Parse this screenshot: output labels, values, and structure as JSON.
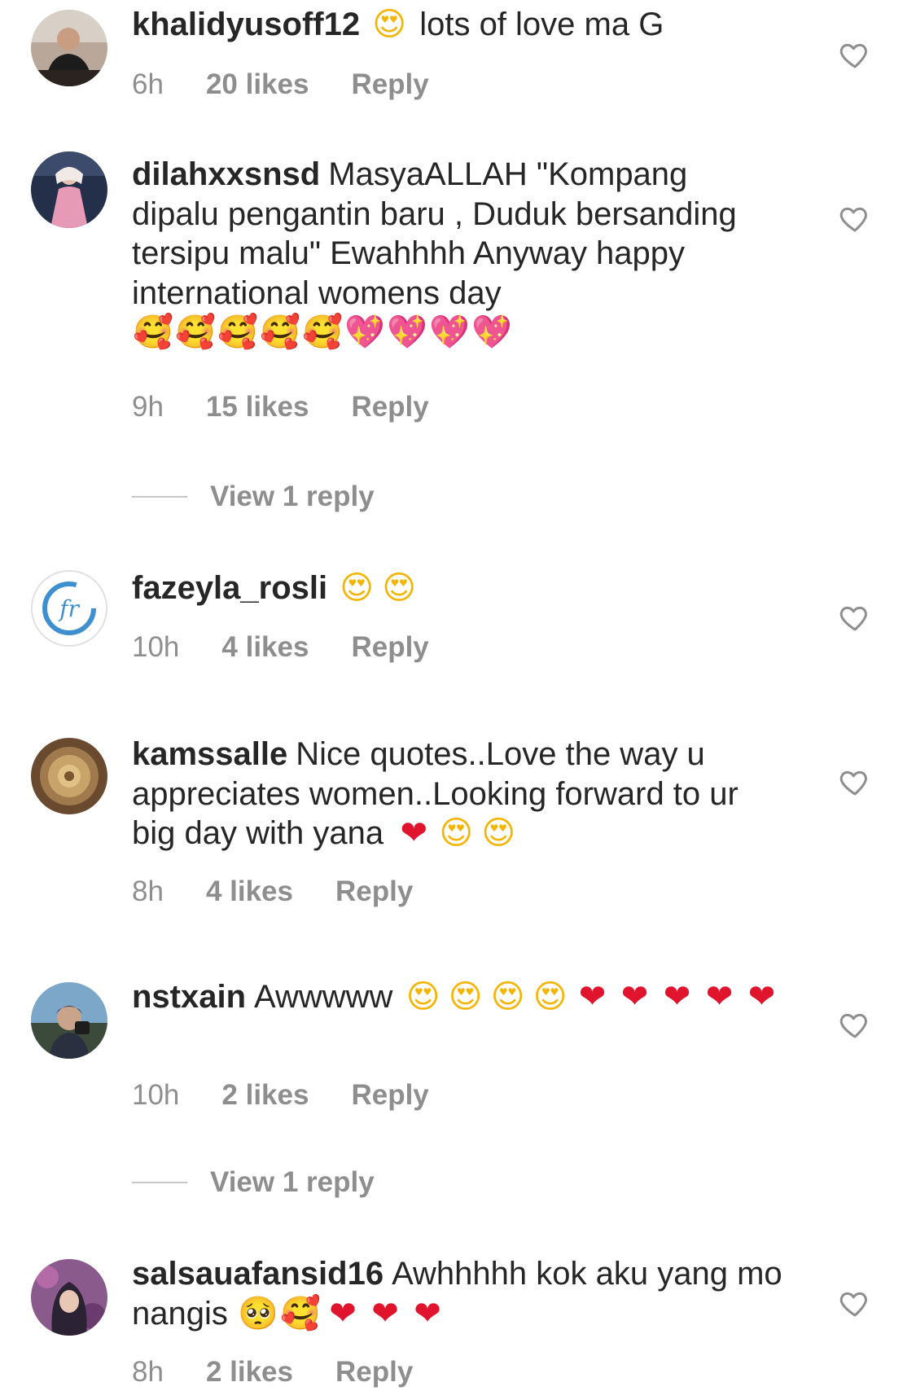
{
  "comments": [
    {
      "username": "khalidyusoff12",
      "text": "lots of love ma G",
      "emojis_before": [
        "heart-eyes"
      ],
      "emojis_after": [],
      "time": "6h",
      "likes": "20 likes",
      "reply": "Reply"
    },
    {
      "username": "dilahxxsnsd",
      "text": "MasyaALLAH \"Kompang dipalu pengantin baru , Duduk bersanding tersipu malu\" Ewahhhh Anyway happy international womens day",
      "emojis_after": [
        "smiling-face-with-hearts",
        "smiling-face-with-hearts",
        "smiling-face-with-hearts",
        "smiling-face-with-hearts",
        "smiling-face-with-hearts",
        "sparkling-heart",
        "sparkling-heart",
        "sparkling-heart",
        "sparkling-heart"
      ],
      "time": "9h",
      "likes": "15 likes",
      "reply": "Reply",
      "view_replies": "View 1 reply"
    },
    {
      "username": "fazeyla_rosli",
      "text": "",
      "emojis_after": [
        "heart-eyes",
        "heart-eyes"
      ],
      "time": "10h",
      "likes": "4 likes",
      "reply": "Reply"
    },
    {
      "username": "kamssalle",
      "text": "Nice quotes..Love the way u appreciates women..Looking forward to ur big day with yana",
      "emojis_after": [
        "red-heart",
        "heart-eyes",
        "heart-eyes"
      ],
      "time": "8h",
      "likes": "4 likes",
      "reply": "Reply"
    },
    {
      "username": "nstxain",
      "text": "Awwwww",
      "emojis_after": [
        "heart-eyes",
        "heart-eyes",
        "heart-eyes",
        "heart-eyes",
        "red-heart",
        "red-heart",
        "red-heart",
        "red-heart",
        "red-heart"
      ],
      "time": "10h",
      "likes": "2 likes",
      "reply": "Reply",
      "view_replies": "View 1 reply"
    },
    {
      "username": "salsauafansid16",
      "text": "Awhhhhh kok aku yang mo nangis",
      "emojis_after": [
        "pleading-face",
        "smiling-face-with-hearts",
        "red-heart",
        "red-heart",
        "red-heart"
      ],
      "time": "8h",
      "likes": "2 likes",
      "reply": "Reply"
    }
  ],
  "icons": {
    "like": "heart-outline-icon"
  },
  "colors": {
    "text": "#262626",
    "meta": "#8e8e8e",
    "background": "#ffffff"
  }
}
